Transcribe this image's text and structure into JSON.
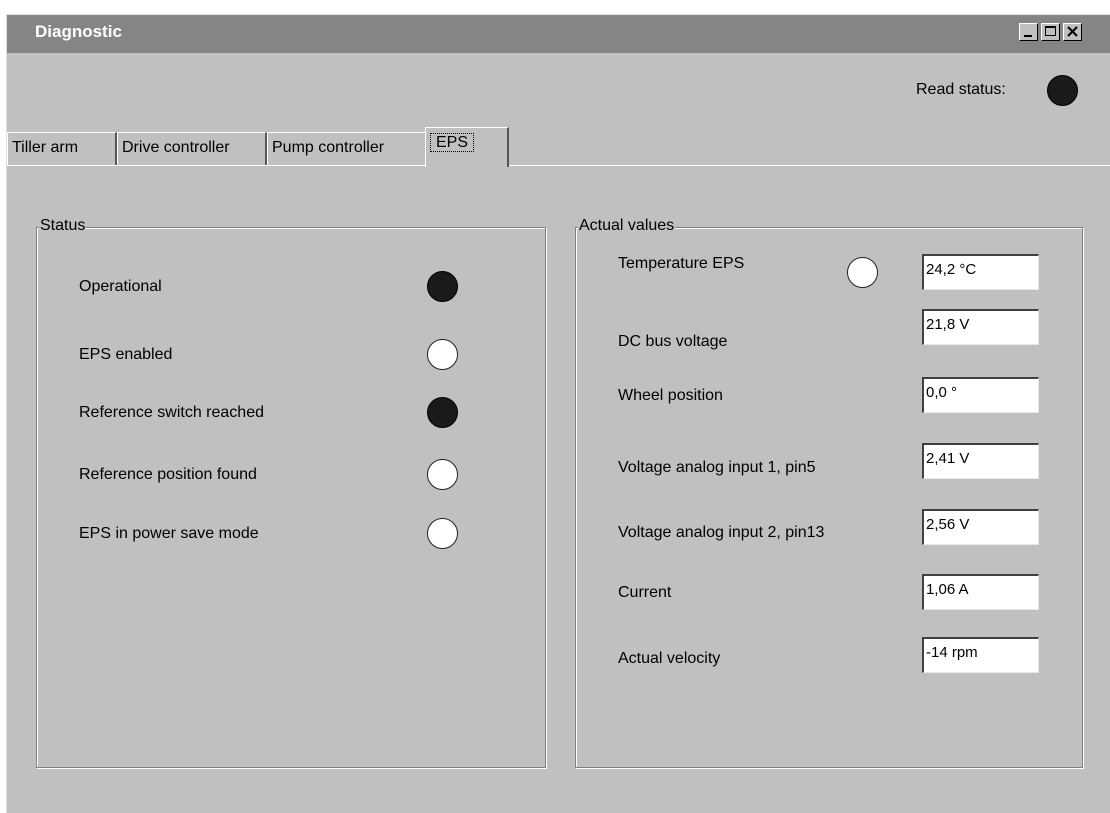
{
  "window": {
    "title": "Diagnostic",
    "minimize": "_",
    "maximize": "□",
    "close": "✕"
  },
  "read_status": {
    "label": "Read status:",
    "state": "on"
  },
  "tabs": [
    {
      "label": "Tiller arm",
      "active": false
    },
    {
      "label": "Drive controller",
      "active": false
    },
    {
      "label": "Pump controller",
      "active": false
    },
    {
      "label": "EPS",
      "active": true
    }
  ],
  "status": {
    "legend": "Status",
    "items": [
      {
        "label": "Operational",
        "state": "on"
      },
      {
        "label": "EPS enabled",
        "state": "off"
      },
      {
        "label": "Reference switch reached",
        "state": "on"
      },
      {
        "label": "Reference position found",
        "state": "off"
      },
      {
        "label": "EPS in power save mode",
        "state": "off"
      }
    ]
  },
  "actual_values": {
    "legend": "Actual values",
    "temperature_indicator_state": "off",
    "items": [
      {
        "label": "Temperature EPS",
        "value": "24,2 °C"
      },
      {
        "label": "DC bus voltage",
        "value": "21,8 V"
      },
      {
        "label": "Wheel position",
        "value": "0,0 °"
      },
      {
        "label": "Voltage analog input 1, pin5",
        "value": "2,41 V"
      },
      {
        "label": "Voltage analog input 2, pin13",
        "value": "2,56 V"
      },
      {
        "label": "Current",
        "value": "1,06 A"
      },
      {
        "label": "Actual velocity",
        "value": "-14 rpm"
      }
    ]
  }
}
